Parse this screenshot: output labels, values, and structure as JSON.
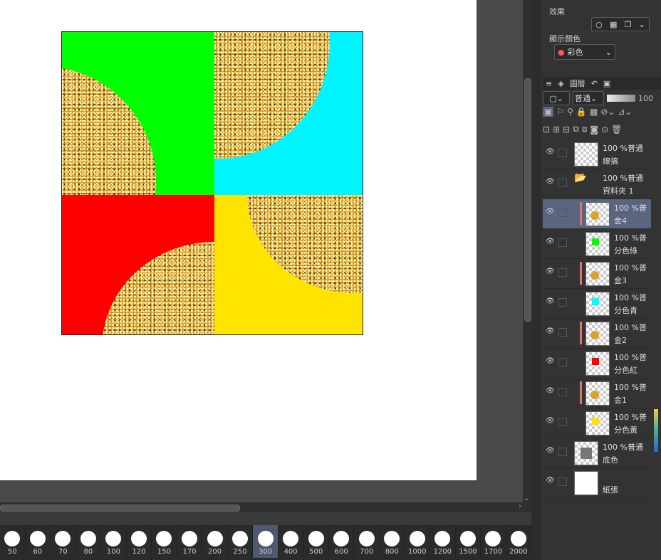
{
  "properties": {
    "effect_label": "效果",
    "display_color_label": "顯示顏色",
    "display_color_value": "彩色"
  },
  "layer_panel": {
    "tab_label": "圖層",
    "blend_mode": "普通",
    "opacity": "100"
  },
  "layers": [
    {
      "pct": "100 %普通",
      "name": "線搞",
      "indent": 0,
      "thumb": "empty"
    },
    {
      "pct": "100 %普通",
      "name": "資料夾 1",
      "indent": 0,
      "thumb": "folder"
    },
    {
      "pct": "100 %普",
      "name": "金4",
      "indent": 1,
      "thumb": "gold",
      "selected": true,
      "clip": true
    },
    {
      "pct": "100 %普",
      "name": "分色綠",
      "indent": 1,
      "thumb": "color",
      "color": "#00ff00"
    },
    {
      "pct": "100 %普",
      "name": "金3",
      "indent": 1,
      "thumb": "gold",
      "clip": true
    },
    {
      "pct": "100 %普",
      "name": "分色青",
      "indent": 1,
      "thumb": "color",
      "color": "#00ffff"
    },
    {
      "pct": "100 %普",
      "name": "金2",
      "indent": 1,
      "thumb": "gold",
      "clip": true
    },
    {
      "pct": "100 %普",
      "name": "分色紅",
      "indent": 1,
      "thumb": "color",
      "color": "#ff0000"
    },
    {
      "pct": "100 %普",
      "name": "金1",
      "indent": 1,
      "thumb": "gold",
      "clip": true
    },
    {
      "pct": "100 %普",
      "name": "分色黃",
      "indent": 1,
      "thumb": "color",
      "color": "#ffe000"
    },
    {
      "pct": "100 %普通",
      "name": "底色",
      "indent": 0,
      "thumb": "gray"
    },
    {
      "pct": "",
      "name": "紙張",
      "indent": 0,
      "thumb": "paper"
    }
  ],
  "brush_sizes": [
    "50",
    "60",
    "70",
    "80",
    "100",
    "120",
    "150",
    "170",
    "200",
    "250",
    "300",
    "400",
    "500",
    "600",
    "700",
    "800",
    "1000",
    "1200",
    "1500",
    "1700",
    "2000"
  ],
  "active_brush_size": "300",
  "artwork_colors": {
    "green": "#00ff00",
    "cyan": "#00f5ff",
    "red": "#ff0000",
    "yellow": "#ffe400",
    "gold": "#d9a22a"
  }
}
